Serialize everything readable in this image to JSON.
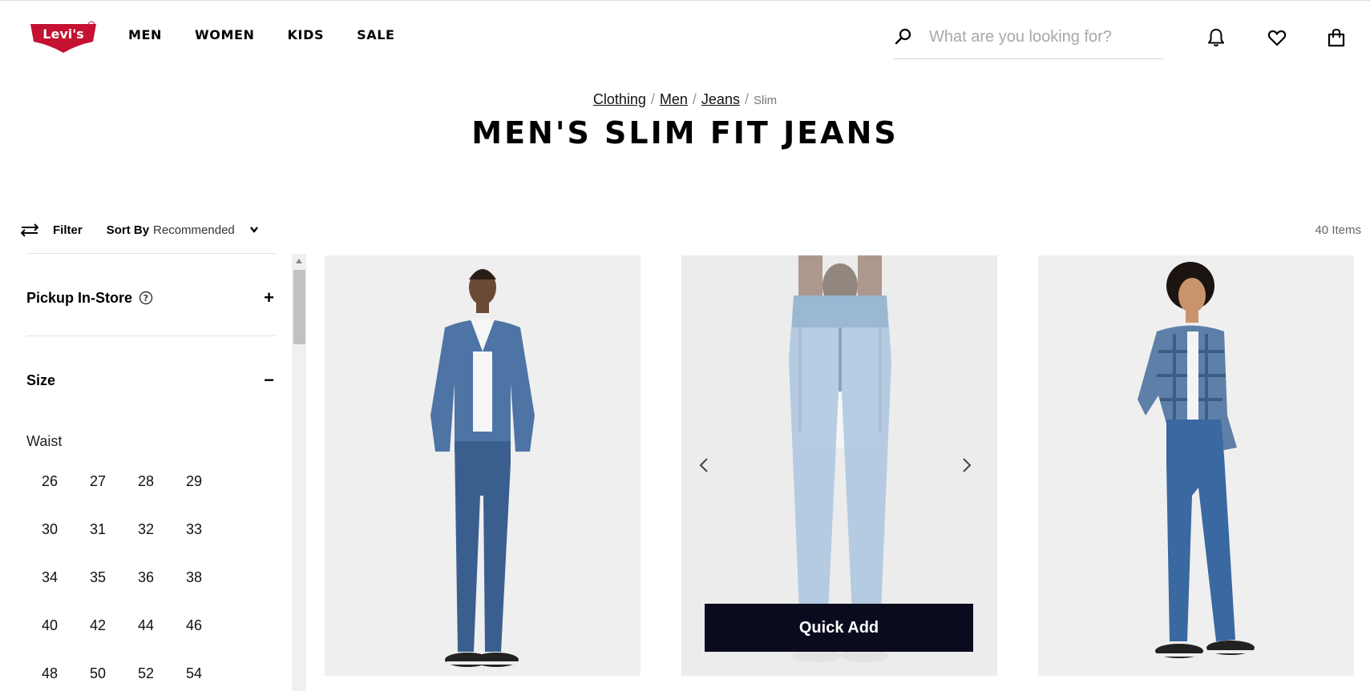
{
  "brand": {
    "logo_text": "Levi's",
    "brand_red": "#c41230"
  },
  "nav": {
    "items": [
      "MEN",
      "WOMEN",
      "KIDS",
      "SALE"
    ]
  },
  "search": {
    "placeholder": "What are you looking for?",
    "value": ""
  },
  "header_icons": [
    "search-icon",
    "bell-icon",
    "heart-icon",
    "bag-icon"
  ],
  "breadcrumb": {
    "links": [
      "Clothing",
      "Men",
      "Jeans"
    ],
    "current": "Slim",
    "separator": "/"
  },
  "page_title": "MEN'S SLIM FIT JEANS",
  "toolbar": {
    "filter_label": "Filter",
    "sort_label": "Sort By",
    "sort_value": "Recommended",
    "item_count": "40 Items"
  },
  "sidebar": {
    "pickup": {
      "label": "Pickup In-Store",
      "toggle": "+"
    },
    "size": {
      "label": "Size",
      "toggle": "−"
    },
    "waist_label": "Waist",
    "waist_sizes": [
      "26",
      "27",
      "28",
      "29",
      "30",
      "31",
      "32",
      "33",
      "34",
      "35",
      "36",
      "38",
      "40",
      "42",
      "44",
      "46",
      "48",
      "50",
      "52",
      "54"
    ]
  },
  "products": {
    "quick_add_label": "Quick Add",
    "colors": {
      "denim_dark": "#3a5f8f",
      "denim_light": "#aac6df",
      "quick_add_bg": "#0a0c1e"
    }
  }
}
